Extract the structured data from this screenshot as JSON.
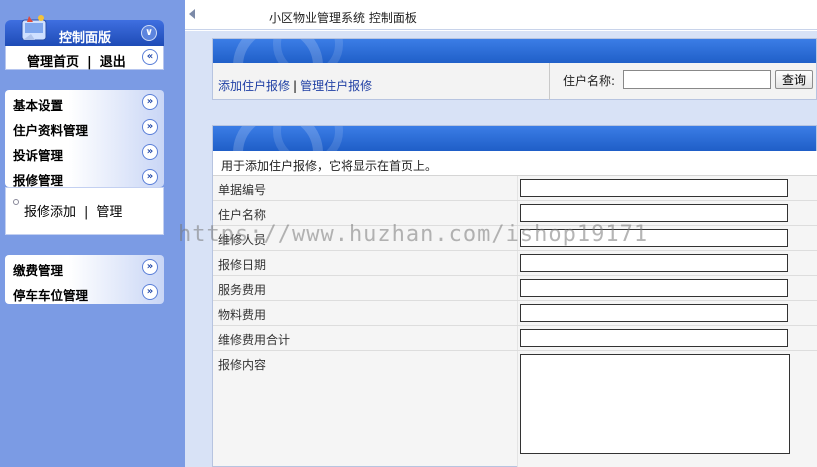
{
  "sidebar": {
    "control_panel": {
      "title": "控制面版",
      "home_link": "管理首页",
      "separator": "|",
      "logout_link": "退出"
    },
    "menu_groups": [
      {
        "items": [
          {
            "label": "基本设置"
          },
          {
            "label": "住户资料管理"
          },
          {
            "label": "投诉管理"
          },
          {
            "label": "报修管理"
          }
        ]
      },
      {
        "items": [
          {
            "label": "缴费管理"
          },
          {
            "label": "停车车位管理"
          }
        ]
      }
    ],
    "submenu": {
      "add_link": "报修添加",
      "separator": "|",
      "manage_link": "管理"
    }
  },
  "header": {
    "title": "小区物业管理系统 控制面板"
  },
  "toolbar": {
    "add_link": "添加住户报修",
    "separator": "|",
    "manage_link": "管理住户报修",
    "search_label": "住户名称:",
    "search_value": "",
    "search_button": "查询"
  },
  "form": {
    "intro": "用于添加住户报修，它将显示在首页上。",
    "fields": [
      {
        "label": "单据编号",
        "value": ""
      },
      {
        "label": "住户名称",
        "value": ""
      },
      {
        "label": "维修人员",
        "value": ""
      },
      {
        "label": "报修日期",
        "value": ""
      },
      {
        "label": "服务费用",
        "value": ""
      },
      {
        "label": "物料费用",
        "value": ""
      },
      {
        "label": "维修费用合计",
        "value": ""
      },
      {
        "label": "报修内容",
        "value": ""
      }
    ]
  },
  "watermark": "https://www.huzhan.com/ishop19171",
  "colors": {
    "sidebar_bg": "#7b9be4",
    "header_blue": "#1f5ec7",
    "link_blue": "#1f3fa4"
  }
}
